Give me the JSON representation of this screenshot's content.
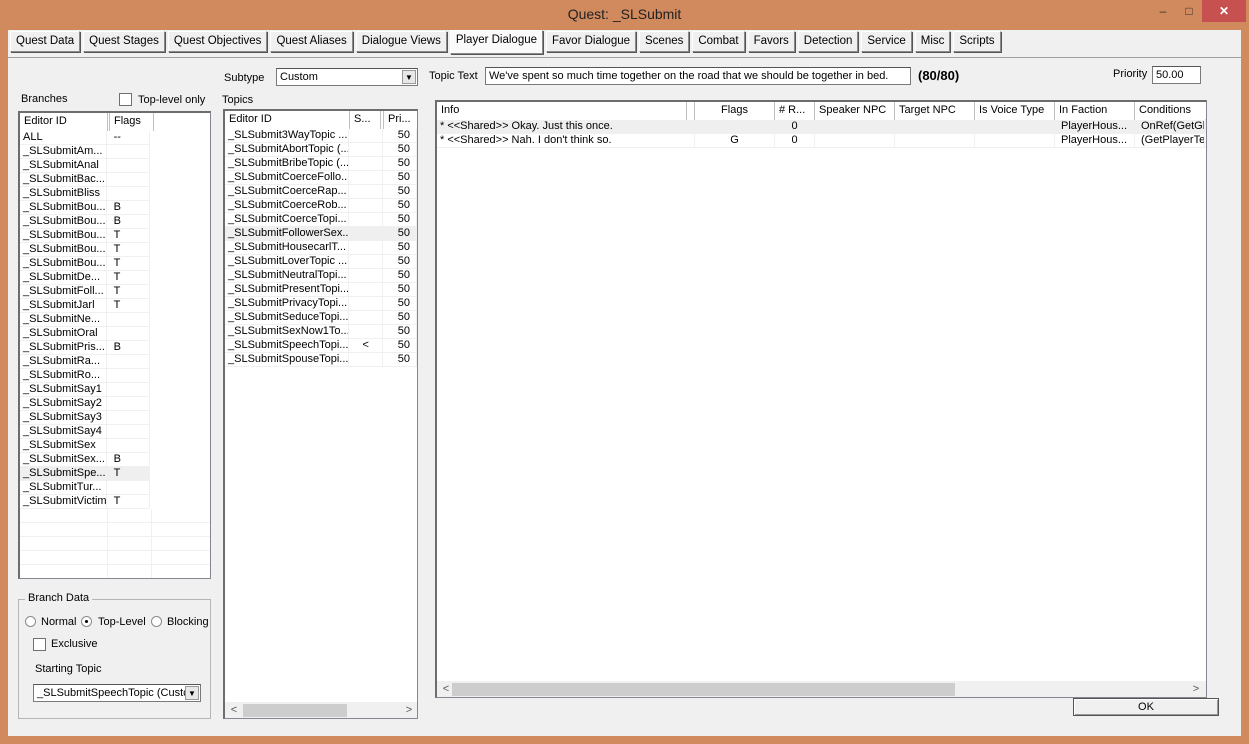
{
  "window": {
    "title": "Quest: _SLSubmit",
    "minimize_glyph": "–",
    "maximize_glyph": "□",
    "close_glyph": "✕"
  },
  "tabs": [
    {
      "label": "Quest Data",
      "active": false
    },
    {
      "label": "Quest Stages",
      "active": false
    },
    {
      "label": "Quest Objectives",
      "active": false
    },
    {
      "label": "Quest Aliases",
      "active": false
    },
    {
      "label": "Dialogue Views",
      "active": false
    },
    {
      "label": "Player Dialogue",
      "active": true
    },
    {
      "label": "Favor Dialogue",
      "active": false
    },
    {
      "label": "Scenes",
      "active": false
    },
    {
      "label": "Combat",
      "active": false
    },
    {
      "label": "Favors",
      "active": false
    },
    {
      "label": "Detection",
      "active": false
    },
    {
      "label": "Service",
      "active": false
    },
    {
      "label": "Misc",
      "active": false
    },
    {
      "label": "Scripts",
      "active": false
    }
  ],
  "branches": {
    "label": "Branches",
    "top_level_only_label": "Top-level only",
    "top_level_only_checked": false,
    "columns": [
      "Editor ID",
      "Flags"
    ],
    "rows": [
      {
        "id": "ALL",
        "flags": "--"
      },
      {
        "id": "_SLSubmitAm...",
        "flags": ""
      },
      {
        "id": "_SLSubmitAnal",
        "flags": ""
      },
      {
        "id": "_SLSubmitBac...",
        "flags": ""
      },
      {
        "id": "_SLSubmitBliss",
        "flags": ""
      },
      {
        "id": "_SLSubmitBou...",
        "flags": "B"
      },
      {
        "id": "_SLSubmitBou...",
        "flags": "B"
      },
      {
        "id": "_SLSubmitBou...",
        "flags": "T"
      },
      {
        "id": "_SLSubmitBou...",
        "flags": "T"
      },
      {
        "id": "_SLSubmitBou...",
        "flags": "T"
      },
      {
        "id": "_SLSubmitDe...",
        "flags": "T"
      },
      {
        "id": "_SLSubmitFoll...",
        "flags": "T"
      },
      {
        "id": "_SLSubmitJarl",
        "flags": "T"
      },
      {
        "id": "_SLSubmitNe...",
        "flags": ""
      },
      {
        "id": "_SLSubmitOral",
        "flags": ""
      },
      {
        "id": "_SLSubmitPris...",
        "flags": "B"
      },
      {
        "id": "_SLSubmitRa...",
        "flags": ""
      },
      {
        "id": "_SLSubmitRo...",
        "flags": ""
      },
      {
        "id": "_SLSubmitSay1",
        "flags": ""
      },
      {
        "id": "_SLSubmitSay2",
        "flags": ""
      },
      {
        "id": "_SLSubmitSay3",
        "flags": ""
      },
      {
        "id": "_SLSubmitSay4",
        "flags": ""
      },
      {
        "id": "_SLSubmitSex",
        "flags": ""
      },
      {
        "id": "_SLSubmitSex...",
        "flags": "B"
      },
      {
        "id": "_SLSubmitSpe...",
        "flags": "T",
        "selected": true
      },
      {
        "id": "_SLSubmitTur...",
        "flags": ""
      },
      {
        "id": "_SLSubmitVictim",
        "flags": "T"
      }
    ]
  },
  "branch_data": {
    "title": "Branch Data",
    "radios": [
      {
        "label": "Normal",
        "checked": false
      },
      {
        "label": "Top-Level",
        "checked": true
      },
      {
        "label": "Blocking",
        "checked": false
      }
    ],
    "exclusive_label": "Exclusive",
    "exclusive_checked": false,
    "starting_topic_label": "Starting Topic",
    "starting_topic_value": "_SLSubmitSpeechTopic (Custc"
  },
  "subtype": {
    "label": "Subtype",
    "value": "Custom"
  },
  "topics": {
    "label": "Topics",
    "columns": [
      "Editor ID",
      "S...",
      "Pri..."
    ],
    "rows": [
      {
        "id": "_SLSubmit3WayTopic ...",
        "s": "",
        "pri": "50"
      },
      {
        "id": "_SLSubmitAbortTopic (...",
        "s": "",
        "pri": "50"
      },
      {
        "id": "_SLSubmitBribeTopic (...",
        "s": "",
        "pri": "50"
      },
      {
        "id": "_SLSubmitCoerceFollo...",
        "s": "",
        "pri": "50"
      },
      {
        "id": "_SLSubmitCoerceRap...",
        "s": "",
        "pri": "50"
      },
      {
        "id": "_SLSubmitCoerceRob...",
        "s": "",
        "pri": "50"
      },
      {
        "id": "_SLSubmitCoerceTopi...",
        "s": "",
        "pri": "50"
      },
      {
        "id": "_SLSubmitFollowerSex...",
        "s": "",
        "pri": "50",
        "selected": true
      },
      {
        "id": "_SLSubmitHousecarlT...",
        "s": "",
        "pri": "50"
      },
      {
        "id": "_SLSubmitLoverTopic ...",
        "s": "",
        "pri": "50"
      },
      {
        "id": "_SLSubmitNeutralTopi...",
        "s": "",
        "pri": "50"
      },
      {
        "id": "_SLSubmitPresentTopi...",
        "s": "",
        "pri": "50"
      },
      {
        "id": "_SLSubmitPrivacyTopi...",
        "s": "",
        "pri": "50"
      },
      {
        "id": "_SLSubmitSeduceTopi...",
        "s": "",
        "pri": "50"
      },
      {
        "id": "_SLSubmitSexNow1To...",
        "s": "",
        "pri": "50"
      },
      {
        "id": "_SLSubmitSpeechTopi...",
        "s": "<",
        "pri": "50"
      },
      {
        "id": "_SLSubmitSpouseTopi...",
        "s": "",
        "pri": "50"
      }
    ]
  },
  "topic_text": {
    "label": "Topic Text",
    "value": "We've spent so much time together on the road that we should be together in bed.",
    "counter": "(80/80)"
  },
  "priority": {
    "label": "Priority",
    "value": "50.00"
  },
  "info": {
    "columns": [
      "Info",
      "",
      "Flags",
      "# R...",
      "Speaker NPC",
      "Target NPC",
      "Is Voice Type",
      "In Faction",
      "Conditions"
    ],
    "rows": [
      {
        "info": "* <<Shared>> Okay. Just this once.",
        "flags": "",
        "r": "0",
        "speaker": "",
        "target": "",
        "voice": "",
        "faction": "PlayerHous...",
        "conditions": "OnRef(GetGl",
        "selected": true
      },
      {
        "info": "* <<Shared>> Nah. I don't think so.",
        "flags": "G",
        "r": "0",
        "speaker": "",
        "target": "",
        "voice": "",
        "faction": "PlayerHous...",
        "conditions": "(GetPlayerTe"
      }
    ]
  },
  "scroll": {
    "left_arrow": "<",
    "right_arrow": ">"
  },
  "ok_label": "OK"
}
